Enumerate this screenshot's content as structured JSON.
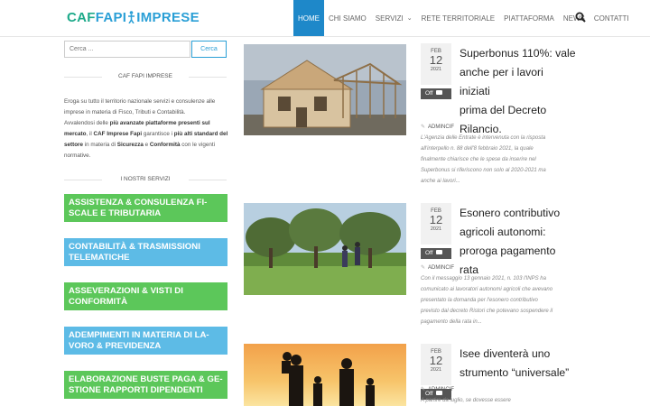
{
  "header": {
    "logo_part1": "CAF",
    "logo_part2": "FAPI",
    "logo_part3": "IMPRESE",
    "nav": [
      "HOME",
      "CHI SIAMO",
      "SERVIZI",
      "RETE TERRITORIALE",
      "PIATTAFORMA",
      "NEWS",
      "CONTATTI"
    ],
    "active": "HOME"
  },
  "sidebar": {
    "search_placeholder": "Cerca ...",
    "search_button": "Cerca",
    "about_title": "CAF FAPI IMPRESE",
    "about_p1": "Eroga su tutto il territorio nazionale servizi e consulenze alle imprese in materia di Fisco, Tributi e Contabilità.",
    "about_p2_a": "Avvalendosi delle ",
    "about_p2_b": "più avanzate piattaforme presenti sul mercato",
    "about_p2_c": ", il ",
    "about_p2_d": "CAF Imprese Fapi",
    "about_p2_e": " garantisce i ",
    "about_p2_f": "più alti standard del settore",
    "about_p2_g": " in materia di ",
    "about_p2_h": "Sicurezza",
    "about_p2_i": " e ",
    "about_p2_j": "Conformità",
    "about_p2_k": " con le vigenti normative.",
    "services_title": "I NOSTRI SERVIZI",
    "services": [
      {
        "line1": "ASSISTENZA & CONSULENZA FI-",
        "line2": "SCALE E TRIBUTARIA",
        "color": "green"
      },
      {
        "line1": "CONTABILITÀ & TRASMISSIONI",
        "line2": "TELEMATICHE",
        "color": "blue"
      },
      {
        "line1": "ASSEVERAZIONI & VISTI DI",
        "line2": "CONFORMITÀ",
        "color": "green"
      },
      {
        "line1": "ADEMPIMENTI IN MATERIA DI LA-",
        "line2": "VORO & PREVIDENZA",
        "color": "blue"
      },
      {
        "line1": "ELABORAZIONE BUSTE PAGA & GE-",
        "line2": "STIONE RAPPORTI DIPENDENTI",
        "color": "green"
      }
    ]
  },
  "posts": [
    {
      "month": "FEB",
      "day": "12",
      "year": "2021",
      "comments": "Off",
      "title_lines": [
        "Superbonus 110%: vale",
        "anche per i lavori iniziati",
        "prima del Decreto",
        "Rilancio."
      ],
      "author": "ADMINCIF",
      "excerpt_lines": [
        "L'Agenzia delle Entrate è intervenuta con la risposta",
        "all'interpello n. 88 dell'8 febbraio 2021, la quale",
        "finalmente chiarisce che le spese da inserire nel",
        "Superbonus si riferiscono non solo al 2020-2021 ma",
        "anche ai lavori..."
      ]
    },
    {
      "month": "FEB",
      "day": "12",
      "year": "2021",
      "comments": "Off",
      "title_lines": [
        "Esonero contributivo",
        "agricoli autonomi:",
        "proroga pagamento rata"
      ],
      "author": "ADMINCIF",
      "excerpt_lines": [
        "Con il messaggio 13 gennaio 2021, n. 103 l'INPS ha",
        "comunicato ai lavoratori autonomi agricoli che avevano",
        "presentato la domanda per l'esonero contributivo",
        "previsto dal decreto Ristori che potevano sospendere il",
        "pagamento della rata in..."
      ]
    },
    {
      "month": "FEB",
      "day": "12",
      "year": "2021",
      "comments": "Off",
      "title_lines": [
        "Isee diventerà uno",
        "strumento “universale”"
      ],
      "author": "ADMINCIF",
      "excerpt_lines": [
        "A partire da luglio, se dovesse essere"
      ]
    }
  ],
  "colors": {
    "brand_green": "#1eaa8a",
    "brand_blue": "#2a9fd6",
    "nav_active": "#1e88c9",
    "service_green": "#5cc75a",
    "service_blue": "#5dbbe6"
  }
}
